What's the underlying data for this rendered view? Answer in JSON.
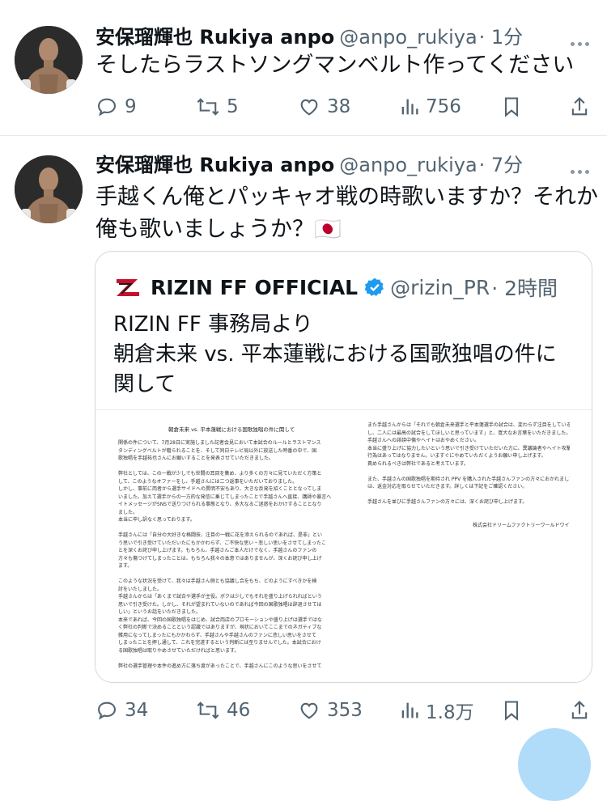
{
  "tweets": [
    {
      "name": "安保瑠輝也 Rukiya anpo",
      "handle": "@anpo_rukiya",
      "time": "· 1分",
      "text_lines": [
        "そしたらラストソングマンベルト作ってください"
      ],
      "replies": "9",
      "retweets": "5",
      "likes": "38",
      "views": "756"
    },
    {
      "name": "安保瑠輝也 Rukiya anpo",
      "handle": "@anpo_rukiya",
      "time": "· 7分",
      "text_lines": [
        "手越くん俺とパッキャオ戦の時歌いますか？それか",
        "俺も歌いましょうか？🇯🇵"
      ],
      "replies": "34",
      "retweets": "46",
      "likes": "353",
      "views": "1.8万",
      "quote": {
        "name": "RIZIN FF OFFICIAL",
        "handle": "@rizin_PR",
        "time": "· 2時間",
        "text_lines": [
          "RIZIN FF 事務局より",
          "朝倉未来 vs. 平本蓮戦における国歌独唱の件に",
          "関して"
        ],
        "doc_title": "朝倉未来 vs. 平本蓮戦における国歌独唱の件に関して",
        "doc_left": [
          "関係の件について、7月28日に実施しました記者会見において本試合のルールとラストマンス",
          "タンディングベルトが贈られることを、そして同日テレビ局以外に放送した時番の中で、国",
          "歌独唱を手越祐也さんにお願いすることを発表させていただきました。",
          "",
          "弊社としては、この一戦が少しでも世間の耳目を集め、より多くの方々に見ていただく方策と",
          "して、このようなオファーをし、手越さんには二つ返事をいただいておりました。",
          "しかし、事前に両者から選手サイドへの異明不安もあり、大きな反発を招くこととなってしま",
          "いました。加えて選手からの一方的な発信に乗じてしまったことで手越さんへ直接、講師や暴言へ",
          "イトメッセージがSNSで送りつけられる事態となり、多大なるご迷惑をおかけすることとなり",
          "ました。",
          "本当に申し訳なく思っております。",
          "",
          "手越さんには「自分の大好きな格闘技、注目の一戦に花を添えられるのであれば、是非」とい",
          "う思いで引き受けていただいたにもかかわらず、ご不快な思い・悲しい思いをさせてしまったこ",
          "とを深くお詫び申し上げます。もちろん、手越さんご本人だけでなく、手越さんのファンの",
          "方々も傷つけてしまったことは、もちろん我々の本意ではありませんが、深くお詫び申し上げ",
          "ます。",
          "",
          "このような状況を受けて、我々は手越さん側とも協議し合をもち、どのようにすべきかを検",
          "討をいたしました。",
          "手越さんからは「あくまで試合や選手が主役。ボクは少しでもそれを盛り上げられればという",
          "思いで引き受けた。しかし、それが望まれていないのであれば今回の国歌独唱は辞退させては",
          "しい」というお話をいただきました。",
          "本来であれば、今回の国歌独唱をはじめ、試合両店のプロモーションや盛り上げは選手ではな",
          "く弊社の判断で決めることという認識ではありますが、現状においてここまでのネガティブな",
          "雑用になってしまったにもかかわらず、手越さんや手越さんのファンに悲しい思いをさせて",
          "しまったことを押し通して、これを完遂するという判断には至りませんでした。本試合におけ",
          "る国歌独唱は取りやめさせていただければと思います。",
          "",
          "弊社の選手管理や本件の進め方に落ち度があったことで、手越さんにこのような思いをさせて"
        ],
        "doc_right": [
          "また手越さんからは「それでも朝倉未来選手と平本蓮選手の試合は、変わらず注目をしている",
          "し、二人には最高の試合をしてほしいと思っています」と、寛大なお言葉をいただきました。",
          "手越さんへの誹謗中傷やヘイトはおやめください。",
          "本当に盛り上げに協力したいという思いで引き受けていただいた方に、異議論者やヘイト攻撃の",
          "行為はあってはなりません。いますぐにやめていただくようお願い申し上げます。",
          "責められるべきは弊社であると考えています。",
          "",
          "また、手越さんの国歌独唱を期待され PPV を購入された手越さんファンの方々におかれまして",
          "は、返金対応を取らせていただきます。詳しくは下記をご確認ください。",
          "",
          "手越さんを並びに手越さんファンの方々には、深くお詫び申し上げます。",
          "",
          "",
          "株式会社ドリームファクトリーワールドワイド"
        ]
      }
    }
  ]
}
